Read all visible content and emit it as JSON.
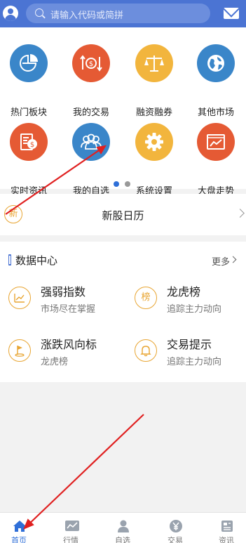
{
  "header": {
    "search_placeholder": "请输入代码或简拼"
  },
  "menu": {
    "items": [
      {
        "label": "热门板块",
        "icon": "pie-chart-icon",
        "color": "#3a86c9"
      },
      {
        "label": "我的交易",
        "icon": "dollar-arrows-icon",
        "color": "#e55a34"
      },
      {
        "label": "融资融券",
        "icon": "scale-icon",
        "color": "#f2b53d"
      },
      {
        "label": "其他市场",
        "icon": "globe-icon",
        "color": "#3a86c9"
      },
      {
        "label": "实时资讯",
        "icon": "document-dollar-icon",
        "color": "#e55a34"
      },
      {
        "label": "我的自选",
        "icon": "users-icon",
        "color": "#3a86c9"
      },
      {
        "label": "系统设置",
        "icon": "gear-icon",
        "color": "#f2b53d"
      },
      {
        "label": "大盘走势",
        "icon": "trend-chart-icon",
        "color": "#e55a34"
      }
    ],
    "pages": 2,
    "active_page": 1
  },
  "ipo": {
    "badge": "新",
    "title": "新股日历"
  },
  "data_center": {
    "title": "数据中心",
    "more": "更多",
    "items": [
      {
        "name": "强弱指数",
        "desc": "市场尽在掌握",
        "icon": "strength-chart-icon"
      },
      {
        "name": "龙虎榜",
        "desc": "追踪主力动向",
        "badge": "榜",
        "icon": "ranking-badge-icon"
      },
      {
        "name": "涨跌风向标",
        "desc": "龙虎榜",
        "icon": "flag-icon"
      },
      {
        "name": "交易提示",
        "desc": "追踪主力动向",
        "icon": "bell-icon"
      }
    ]
  },
  "bottom_nav": {
    "items": [
      {
        "label": "首页",
        "active": true
      },
      {
        "label": "行情",
        "active": false
      },
      {
        "label": "自选",
        "active": false
      },
      {
        "label": "交易",
        "active": false
      },
      {
        "label": "资讯",
        "active": false
      }
    ]
  },
  "colors": {
    "primary": "#4b74d3",
    "accent_blue": "#3a86c9",
    "accent_red": "#e55a34",
    "accent_yellow": "#f2b53d",
    "annotation": "#e02020"
  }
}
